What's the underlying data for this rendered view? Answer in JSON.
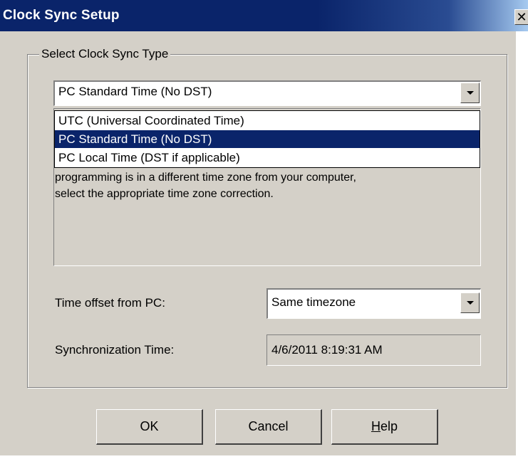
{
  "window": {
    "title": "Clock Sync Setup",
    "close_glyph": "✕"
  },
  "group": {
    "legend": "Select Clock Sync Type"
  },
  "sync_type": {
    "selected": "PC Standard Time (No DST)",
    "options": [
      "UTC (Universal Coordinated Time)",
      "PC Standard Time (No DST)",
      "PC Local Time (DST if applicable)"
    ],
    "highlighted_index": 1
  },
  "description": {
    "line1": "programming is in a different time zone from your computer,",
    "line2": "select the appropriate time zone correction."
  },
  "offset": {
    "label": "Time offset from PC:",
    "value": "Same timezone"
  },
  "sync_time": {
    "label": "Synchronization Time:",
    "value": "4/6/2011 8:19:31 AM"
  },
  "buttons": {
    "ok": "OK",
    "cancel": "Cancel",
    "help_mnemonic": "H",
    "help_rest": "elp"
  },
  "colors": {
    "titlebar": "#0a246a",
    "face": "#d4d0c8",
    "selection": "#0a246a"
  }
}
